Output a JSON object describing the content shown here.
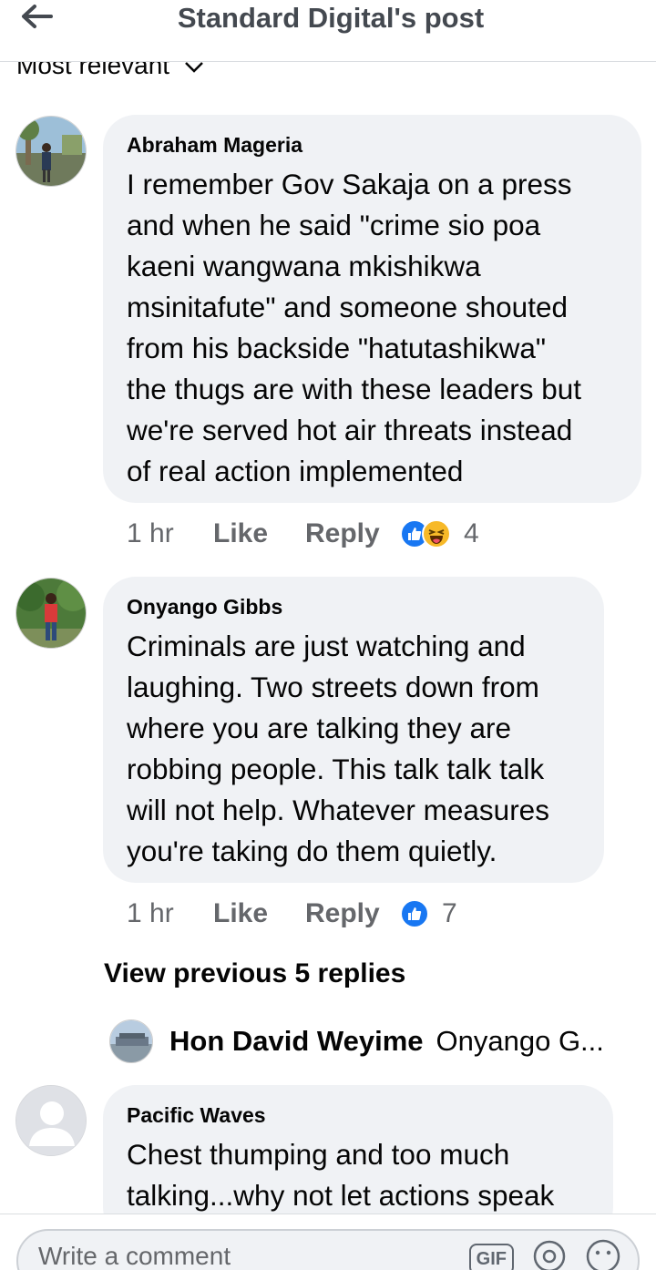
{
  "header": {
    "title": "Standard Digital's post",
    "back_icon": "arrow-left-icon"
  },
  "sort": {
    "label": "Most relevant",
    "icon": "chevron-down-icon"
  },
  "comments": [
    {
      "author": "Abraham Mageria",
      "text_lines": [
        "I remember Gov Sakaja on a press",
        "and when he said \"crime sio poa",
        "kaeni wangwana mkishikwa",
        "msinitafute\" and someone shouted",
        "from his backside \"hatutashikwa\"",
        "the thugs are with these leaders but",
        "we're served hot air threats instead",
        "of real action implemented"
      ],
      "time": "1 hr",
      "like_label": "Like",
      "reply_label": "Reply",
      "reactions": [
        "like-icon",
        "haha-icon"
      ],
      "reaction_count": "4"
    },
    {
      "author": "Onyango Gibbs",
      "text_lines": [
        "Criminals are just watching and",
        "laughing. Two streets down from",
        "where you are talking they are",
        "robbing people. This talk talk talk",
        "will not help. Whatever measures",
        "you're taking do them quietly."
      ],
      "time": "1 hr",
      "like_label": "Like",
      "reply_label": "Reply",
      "reactions": [
        "like-icon"
      ],
      "reaction_count": "7"
    },
    {
      "author": "Pacific Waves",
      "text_lines": [
        "Chest thumping and too much",
        "talking...why not let actions speak"
      ]
    }
  ],
  "view_previous": "View previous 5 replies",
  "reply_preview": {
    "author": "Hon David Weyime",
    "text": "Onyango G..."
  },
  "composer": {
    "placeholder": "Write a comment",
    "gif_label": "GIF",
    "icons": [
      "gif-icon",
      "sticker-icon",
      "emoji-icon"
    ]
  },
  "colors": {
    "bubble": "#f0f2f5",
    "like_blue": "#1877f2",
    "haha_yellow": "#f7b928",
    "meta_gray": "#65676b"
  }
}
